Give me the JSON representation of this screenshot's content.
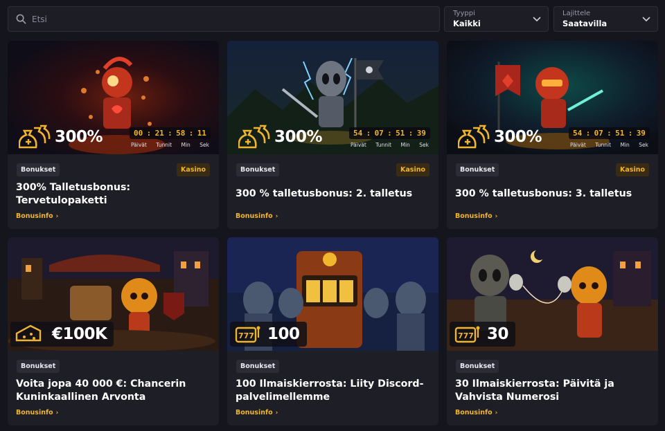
{
  "search": {
    "placeholder": "Etsi"
  },
  "filters": {
    "type": {
      "label": "Tyyppi",
      "value": "Kaikki"
    },
    "sort": {
      "label": "Lajittele",
      "value": "Saatavilla"
    }
  },
  "timer_units": [
    "Päivät",
    "Tunnit",
    "Min",
    "Sek"
  ],
  "cards": [
    {
      "title": "300% Talletusbonus: Tervetulopaketti",
      "tag": "Bonukset",
      "category": "Kasino",
      "badge": "300%",
      "timer": [
        "00",
        "21",
        "58",
        "11"
      ],
      "link": "Bonusinfo"
    },
    {
      "title": "300 % talletusbonus: 2. talletus",
      "tag": "Bonukset",
      "category": "Kasino",
      "badge": "300%",
      "timer": [
        "54",
        "07",
        "51",
        "39"
      ],
      "link": "Bonusinfo"
    },
    {
      "title": "300 % talletusbonus: 3. talletus",
      "tag": "Bonukset",
      "category": "Kasino",
      "badge": "300%",
      "timer": [
        "54",
        "07",
        "51",
        "39"
      ],
      "link": "Bonusinfo"
    },
    {
      "title": "Voita jopa 40 000 €: Chancerin Kuninkaallinen Arvonta",
      "tag": "Bonukset",
      "badge": "€100K",
      "link": "Bonusinfo"
    },
    {
      "title": "100 Ilmaiskierrosta: Liity Discord-palvelimellemme",
      "tag": "Bonukset",
      "badge": "100",
      "link": "Bonusinfo"
    },
    {
      "title": "30 Ilmaiskierrosta: Päivitä ja Vahvista Numerosi",
      "tag": "Bonukset",
      "badge": "30",
      "link": "Bonusinfo"
    }
  ],
  "colors": {
    "accent": "#f1b52e",
    "background": "#15151d",
    "card": "#1e1e27"
  },
  "icons": {
    "search": "search-icon",
    "chevron": "chevron-down-icon",
    "money_bags": "money-bags-icon",
    "ticket": "ticket-icon",
    "slot": "slot-machine-icon"
  }
}
